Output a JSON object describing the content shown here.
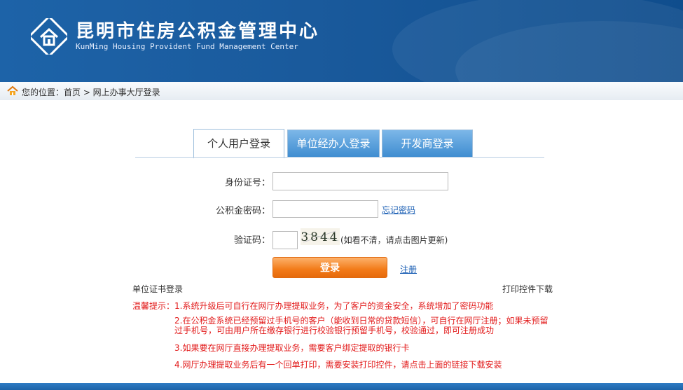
{
  "header": {
    "title": "昆明市住房公积金管理中心",
    "subtitle": "KunMing Housing Provident Fund Management Center",
    "logo_icon": "house-logo-icon",
    "colors": {
      "header_bg": "#1a5a9c"
    }
  },
  "breadcrumb": {
    "icon": "home-icon",
    "text": "您的位置：首页 > 网上办事大厅登录"
  },
  "tabs": [
    {
      "label": "个人用户登录",
      "active": true
    },
    {
      "label": "单位经办人登录",
      "active": false
    },
    {
      "label": "开发商登录",
      "active": false
    }
  ],
  "form": {
    "id_label": "身份证号：",
    "id_value": "",
    "password_label": "公积金密码：",
    "password_value": "",
    "forgot_password": "忘记密码",
    "captcha_label": "验证码：",
    "captcha_value": "",
    "captcha_image_text": "3844",
    "captcha_hint": "(如看不清，请点击图片更新)",
    "login_button": "登录",
    "register_link": "注册"
  },
  "links": {
    "cert_login": "单位证书登录",
    "print_download": "打印控件下载"
  },
  "tips": {
    "label": "温馨提示：",
    "items": [
      "1.系统升级后可自行在网厅办理提取业务，为了客户的资金安全，系统增加了密码功能",
      "2.在公积金系统已经预留过手机号的客户（能收到日常的贷款短信），可自行在网厅注册；如果未预留过手机号，可由用户所在缴存银行进行校验银行预留手机号，校验通过，即可注册成功",
      "3.如果要在网厅直接办理提取业务，需要客户绑定提取的银行卡",
      "4.网厅办理提取业务后有一个回单打印，需要安装打印控件，请点击上面的链接下载安装"
    ]
  },
  "colors": {
    "accent_orange": "#f27b19",
    "tab_blue": "#3e8cd0",
    "tip_red": "#e21a1a",
    "link_blue": "#1b5fb4"
  }
}
